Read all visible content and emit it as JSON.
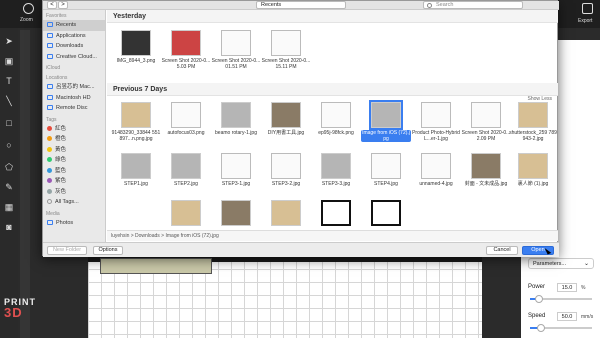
{
  "app": {
    "zoom_label": "Zoom",
    "export_label": "Export"
  },
  "dialog": {
    "location": "Recents",
    "search_placeholder": "Search",
    "nav_back": "<",
    "nav_forward": ">"
  },
  "sidebar": {
    "favorites_header": "Favorites",
    "favorites": [
      "Recents",
      "Applications",
      "Downloads",
      "Creative Cloud..."
    ],
    "icloud_header": "iCloud",
    "locations_header": "Locations",
    "locations": [
      "呂昱芯的 Mac...",
      "Macintosh HD",
      "Remote Disc"
    ],
    "tags_header": "Tags",
    "tags": [
      {
        "label": "紅色",
        "color": "#e74c3c"
      },
      {
        "label": "橙色",
        "color": "#f39c12"
      },
      {
        "label": "黃色",
        "color": "#f1c40f"
      },
      {
        "label": "綠色",
        "color": "#2ecc71"
      },
      {
        "label": "藍色",
        "color": "#3498db"
      },
      {
        "label": "紫色",
        "color": "#9b59b6"
      },
      {
        "label": "灰色",
        "color": "#95a5a6"
      },
      {
        "label": "All Tags...",
        "color": ""
      }
    ],
    "media_header": "Media",
    "media": [
      "Photos"
    ]
  },
  "sections": {
    "yesterday": "Yesterday",
    "previous": "Previous 7 Days",
    "show_less": "Show Less"
  },
  "files_yesterday": [
    "IMG_8944_3.png",
    "Screen Shot 2020-0...5.03 PM",
    "Screen Shot 2020-0...01.51 PM",
    "Screen Shot 2020-0...15.11 PM"
  ],
  "files_row1": [
    "91483290_33844 551897...n.png.jpg",
    "autofocus03.png",
    "beamo rotary-1.jpg",
    "DIY用書工具.jpg",
    "ep95j-98fck.png",
    "Image from iOS (72).jpg",
    "Product Photo-Hybrid L...er-1.jpg",
    "Screen Shot 2020-0...2.09 PM",
    "shutterstock_259 789943-2.jpg"
  ],
  "files_row2": [
    "STEP1.jpg",
    "STEP2.jpg",
    "STEP3-1.jpg",
    "STEP3-2.jpg",
    "STEP3-3.jpg",
    "STEP4.jpg",
    "unnamed-4.jpg",
    "封面 - 文未成品.jpg",
    "裏人節 (1).jpg"
  ],
  "path": "luyehsin > Downloads > Image from iOS (72).jpg",
  "buttons": {
    "new_folder": "New Folder",
    "options": "Options",
    "cancel": "Cancel",
    "open": "Open"
  },
  "panel": {
    "parameters": "Parameters...",
    "power_label": "Power",
    "power_value": "15.0",
    "power_unit": "%",
    "power_fraction": 0.15,
    "speed_label": "Speed",
    "speed_value": "50.0",
    "speed_unit": "mm/s",
    "speed_fraction": 0.17
  },
  "logo": {
    "line1": "PRINT",
    "line2": "3D"
  }
}
